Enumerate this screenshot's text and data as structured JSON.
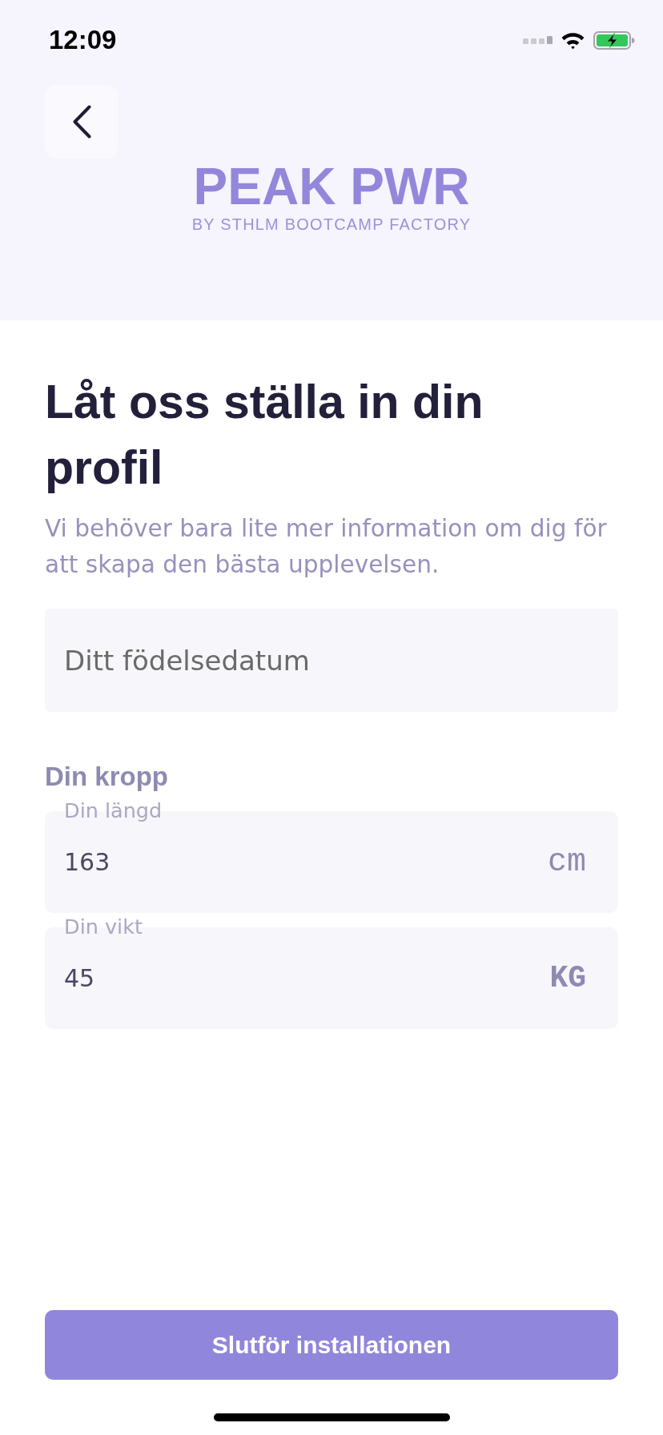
{
  "status_bar": {
    "time": "12:09"
  },
  "header": {
    "logo": "PEAK PWR",
    "tagline": "BY STHLM BOOTCAMP FACTORY"
  },
  "title": "Låt oss ställa in din profil",
  "subtitle": "Vi behöver bara lite mer information om dig för att skapa den bästa upplevelsen.",
  "birthdate_field": {
    "placeholder": "Ditt födelsedatum"
  },
  "body_section": {
    "heading": "Din kropp",
    "fields": [
      {
        "kind": "length",
        "label": "Din längd",
        "value": "163",
        "unit": "cm"
      },
      {
        "kind": "mass",
        "label": "Din vikt",
        "value": "45",
        "unit": "KG"
      }
    ]
  },
  "primary_button": {
    "label": "Slutför installationen"
  }
}
